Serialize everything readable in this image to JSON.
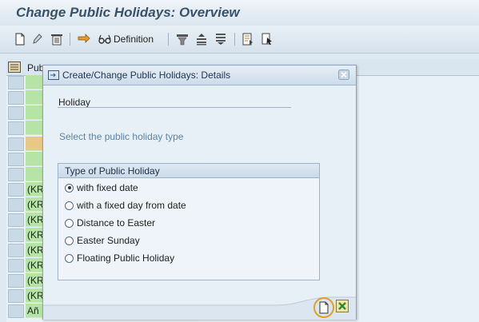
{
  "title": "Change Public Holidays: Overview",
  "toolbar": {
    "definition_label": "Definition"
  },
  "table": {
    "column_header": "Pub",
    "rows": [
      "",
      "",
      "",
      "",
      "",
      "",
      "",
      "(KR",
      "(KR",
      "(KR",
      "(KR",
      "(KR",
      "(KR",
      "(KR",
      "(KR",
      "Añ"
    ]
  },
  "dialog": {
    "title": "Create/Change Public Holidays: Details",
    "holiday_label": "Holiday",
    "hint": "Select the public holiday type",
    "group_title": "Type of Public Holiday",
    "options": [
      {
        "label": "with fixed date",
        "selected": true
      },
      {
        "label": "with a fixed day from date",
        "selected": false
      },
      {
        "label": "Distance to Easter",
        "selected": false
      },
      {
        "label": "Easter Sunday",
        "selected": false
      },
      {
        "label": "Floating Public Holiday",
        "selected": false
      }
    ]
  },
  "colors": {
    "row_green": "#b5e4a6",
    "row_selected": "#e8c882",
    "highlight_ring": "#e0a21f"
  }
}
